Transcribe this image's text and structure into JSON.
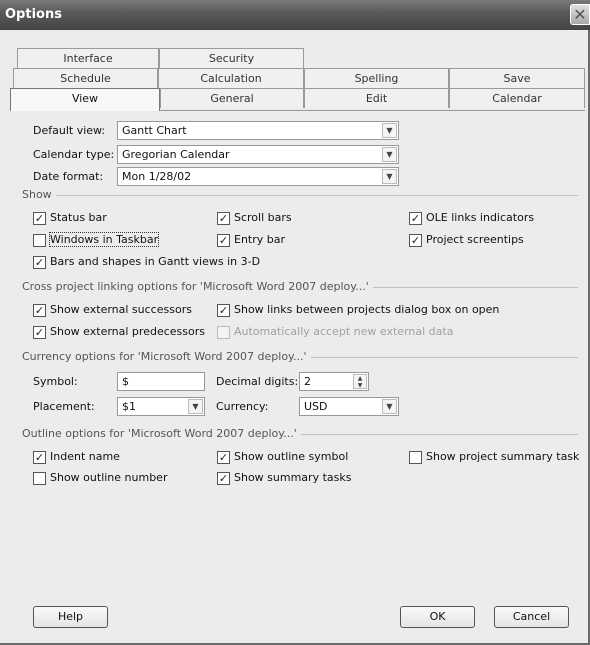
{
  "window": {
    "title": "Options",
    "close_glyph": "✕"
  },
  "tabs": {
    "row1": [
      "Interface",
      "Security"
    ],
    "row2": [
      "Schedule",
      "Calculation",
      "Spelling",
      "Save"
    ],
    "row3": [
      "View",
      "General",
      "Edit",
      "Calendar"
    ],
    "active": "View"
  },
  "view": {
    "default_view_label": "Default view:",
    "default_view_value": "Gantt Chart",
    "calendar_type_label": "Calendar type:",
    "calendar_type_value": "Gregorian Calendar",
    "date_format_label": "Date format:",
    "date_format_value": "Mon 1/28/02"
  },
  "show": {
    "title": "Show",
    "status_bar": {
      "label": "Status bar",
      "checked": true
    },
    "scroll_bars": {
      "label": "Scroll bars",
      "checked": true
    },
    "ole_links": {
      "label": "OLE links indicators",
      "checked": true
    },
    "windows_in_taskbar": {
      "label": "Windows in Taskbar",
      "checked": false
    },
    "entry_bar": {
      "label": "Entry bar",
      "checked": true
    },
    "project_screentips": {
      "label": "Project screentips",
      "checked": true
    },
    "bars_3d": {
      "label": "Bars and shapes in Gantt views in 3-D",
      "checked": true
    }
  },
  "cross_project": {
    "title": "Cross project linking options for 'Microsoft Word 2007 deploy...'",
    "external_successors": {
      "label": "Show external successors",
      "checked": true
    },
    "show_links_dialog": {
      "label": "Show links between projects dialog box on open",
      "checked": true
    },
    "external_predecessors": {
      "label": "Show external predecessors",
      "checked": true
    },
    "auto_accept": {
      "label": "Automatically accept new external data",
      "checked": false
    }
  },
  "currency": {
    "title": "Currency options for 'Microsoft Word 2007 deploy...'",
    "symbol_label": "Symbol:",
    "symbol_value": "$",
    "decimal_label": "Decimal digits:",
    "decimal_value": "2",
    "placement_label": "Placement:",
    "placement_value": "$1",
    "currency_label": "Currency:",
    "currency_value": "USD"
  },
  "outline": {
    "title": "Outline options for 'Microsoft Word 2007 deploy...'",
    "indent_name": {
      "label": "Indent name",
      "checked": true
    },
    "outline_symbol": {
      "label": "Show outline symbol",
      "checked": true
    },
    "project_summary": {
      "label": "Show project summary task",
      "checked": false
    },
    "outline_number": {
      "label": "Show outline number",
      "checked": false
    },
    "summary_tasks": {
      "label": "Show summary tasks",
      "checked": true
    }
  },
  "buttons": {
    "help": "Help",
    "ok": "OK",
    "cancel": "Cancel"
  },
  "glyphs": {
    "check": "✓",
    "dropdown": "▼",
    "spin_up": "▲",
    "spin_down": "▼"
  }
}
